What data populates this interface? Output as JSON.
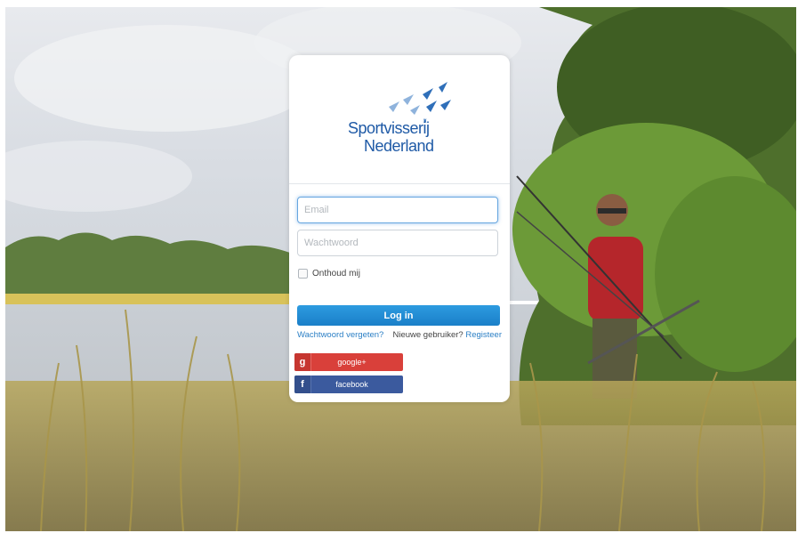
{
  "brand": {
    "line1": "Sportvisserij",
    "line2": "Nederland",
    "color": "#1f5aa6"
  },
  "form": {
    "email_placeholder": "Email",
    "password_placeholder": "Wachtwoord",
    "remember_label": "Onthoud mij",
    "login_label": "Log in",
    "forgot_label": "Wachtwoord vergeten?",
    "new_user_label": "Nieuwe gebruiker?",
    "register_label": "Registeer"
  },
  "social": {
    "google": {
      "icon": "g",
      "label": "google+",
      "color": "#d9403a"
    },
    "facebook": {
      "icon": "f",
      "label": "facebook",
      "color": "#3b5a9e"
    }
  },
  "colors": {
    "primary_button": "#1a8ad4",
    "link": "#2b7fc5"
  }
}
